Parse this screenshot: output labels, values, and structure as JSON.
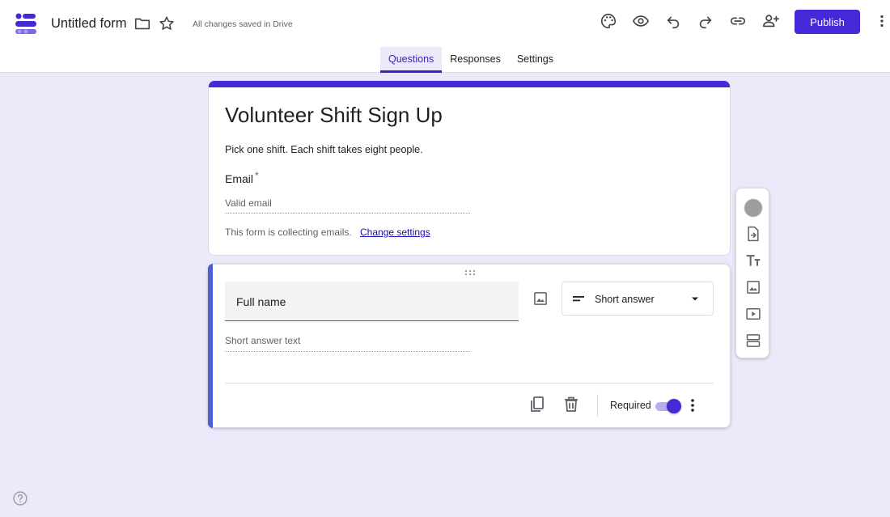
{
  "app": {
    "doc_title": "Untitled form",
    "save_status": "All changes saved in Drive",
    "publish_label": "Publish",
    "accent_color": "#4629d6"
  },
  "header_icons": [
    "folder-icon",
    "star-icon",
    "palette-icon",
    "eye-icon",
    "undo-icon",
    "redo-icon",
    "link-icon",
    "add-collaborator-icon",
    "more-vert-icon"
  ],
  "tabs": [
    {
      "label": "Questions",
      "active": true
    },
    {
      "label": "Responses",
      "active": false
    },
    {
      "label": "Settings",
      "active": false
    }
  ],
  "form": {
    "title": "Volunteer Shift Sign Up",
    "description": "Pick one shift. Each shift takes eight people.",
    "email_label": "Email",
    "required_marker": "*",
    "email_placeholder": "Valid email",
    "collecting_note": "This form is collecting emails.",
    "change_settings_link": "Change settings"
  },
  "question": {
    "title": "Full name",
    "type": "Short answer",
    "answer_hint": "Short answer text",
    "required_label": "Required",
    "required": true
  },
  "toolbar_icons": [
    "add-question-icon",
    "import-questions-icon",
    "add-title-icon",
    "add-image-icon",
    "add-video-icon",
    "add-section-icon"
  ]
}
